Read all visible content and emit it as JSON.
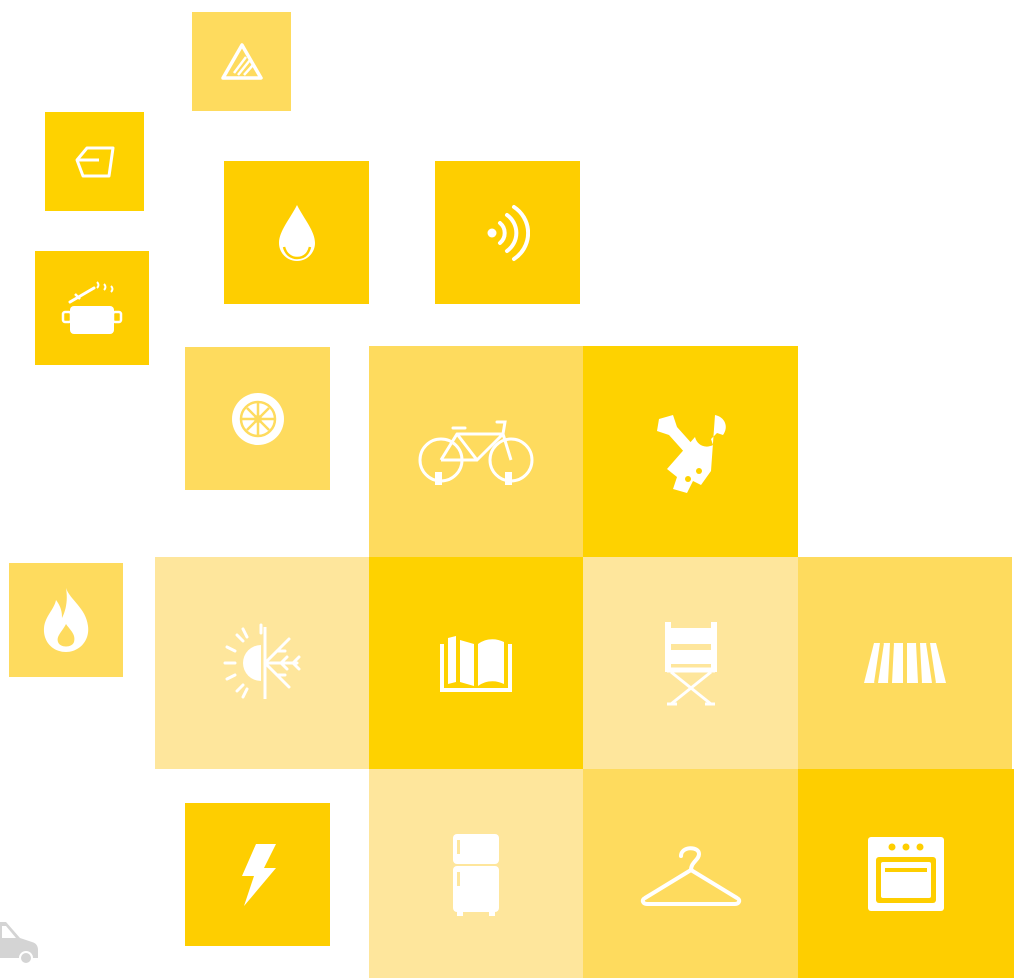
{
  "colors": {
    "strong": "#fed200",
    "medium": "#fedb5e",
    "pale": "#fee69c",
    "icon": "#ffffff",
    "truck": "#d4d4d4"
  },
  "tiles": [
    {
      "icon": "road-warning-icon",
      "shade": "medium"
    },
    {
      "icon": "floor-tile-icon",
      "shade": "strong"
    },
    {
      "icon": "water-drop-icon",
      "shade": "strong"
    },
    {
      "icon": "wireless-signal-icon",
      "shade": "strong"
    },
    {
      "icon": "cooking-pot-icon",
      "shade": "strong"
    },
    {
      "icon": "tire-wheel-icon",
      "shade": "medium"
    },
    {
      "icon": "bicycle-icon",
      "shade": "medium"
    },
    {
      "icon": "tools-icon",
      "shade": "strong"
    },
    {
      "icon": "flame-icon",
      "shade": "medium"
    },
    {
      "icon": "sun-snow-icon",
      "shade": "pale"
    },
    {
      "icon": "open-book-icon",
      "shade": "strong"
    },
    {
      "icon": "directors-chair-icon",
      "shade": "pale"
    },
    {
      "icon": "awning-icon",
      "shade": "medium"
    },
    {
      "icon": "lightning-bolt-icon",
      "shade": "strong"
    },
    {
      "icon": "refrigerator-icon",
      "shade": "pale"
    },
    {
      "icon": "clothes-hanger-icon",
      "shade": "medium"
    },
    {
      "icon": "oven-icon",
      "shade": "strong"
    },
    {
      "icon": "delivery-truck-icon",
      "shade": "none"
    }
  ]
}
